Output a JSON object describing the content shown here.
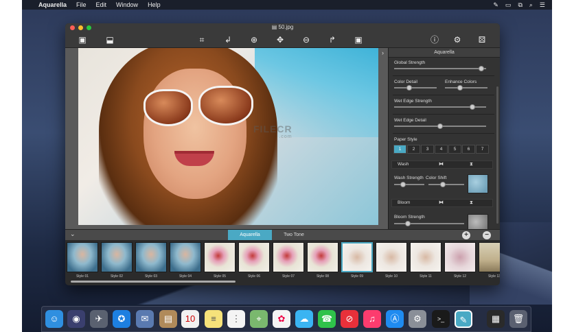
{
  "menubar": {
    "apple": "",
    "app_name": "Aquarella",
    "menus": [
      "File",
      "Edit",
      "Window",
      "Help"
    ]
  },
  "window": {
    "title": "50.jpg"
  },
  "photo_watermark": {
    "main": "FILECR",
    "sub": ".com"
  },
  "panel": {
    "title": "Aquarella",
    "global_strength": {
      "label": "Global Strength",
      "value": 0.95
    },
    "color_detail": {
      "label": "Color Detail",
      "value": 0.35
    },
    "enhance_colors": {
      "label": "Enhance Colors",
      "value": 0.35
    },
    "wet_edge_strength": {
      "label": "Wet Edge Strength",
      "value": 0.85
    },
    "wet_edge_detail": {
      "label": "Wet Edge Detail",
      "value": 0.5
    },
    "paper_style": {
      "label": "Paper Style",
      "options": [
        "1",
        "2",
        "3",
        "4",
        "5",
        "6",
        "7"
      ],
      "selected": "1"
    },
    "wash": {
      "label": "Wash"
    },
    "wash_strength": {
      "label": "Wash Strength",
      "value": 0.3
    },
    "color_shift": {
      "label": "Color Shift",
      "value": 0.4
    },
    "bloom": {
      "label": "Bloom"
    },
    "bloom_strength": {
      "label": "Bloom Strength",
      "value": 0.2
    }
  },
  "style_bar": {
    "tabs": [
      "Aquarella",
      "Two Tone"
    ],
    "active_tab": "Aquarella"
  },
  "styles": [
    {
      "label": "Style 01",
      "look": "blue"
    },
    {
      "label": "Style 02",
      "look": "blue"
    },
    {
      "label": "Style 03",
      "look": "blue"
    },
    {
      "label": "Style 04",
      "look": "blue"
    },
    {
      "label": "Style 05",
      "look": "flower"
    },
    {
      "label": "Style 06",
      "look": "flower"
    },
    {
      "label": "Style 07",
      "look": "flower"
    },
    {
      "label": "Style 08",
      "look": "flower"
    },
    {
      "label": "Style 09",
      "look": "pale",
      "selected": true
    },
    {
      "label": "Style 10",
      "look": "pale"
    },
    {
      "label": "Style 11",
      "look": "pale"
    },
    {
      "label": "Style 12",
      "look": "pink"
    },
    {
      "label": "Style 13",
      "look": "ship"
    }
  ],
  "colors": {
    "accent": "#4aa9c4",
    "traffic_close": "#fc5f57",
    "traffic_min": "#fdbc2e",
    "traffic_max": "#28c840"
  }
}
